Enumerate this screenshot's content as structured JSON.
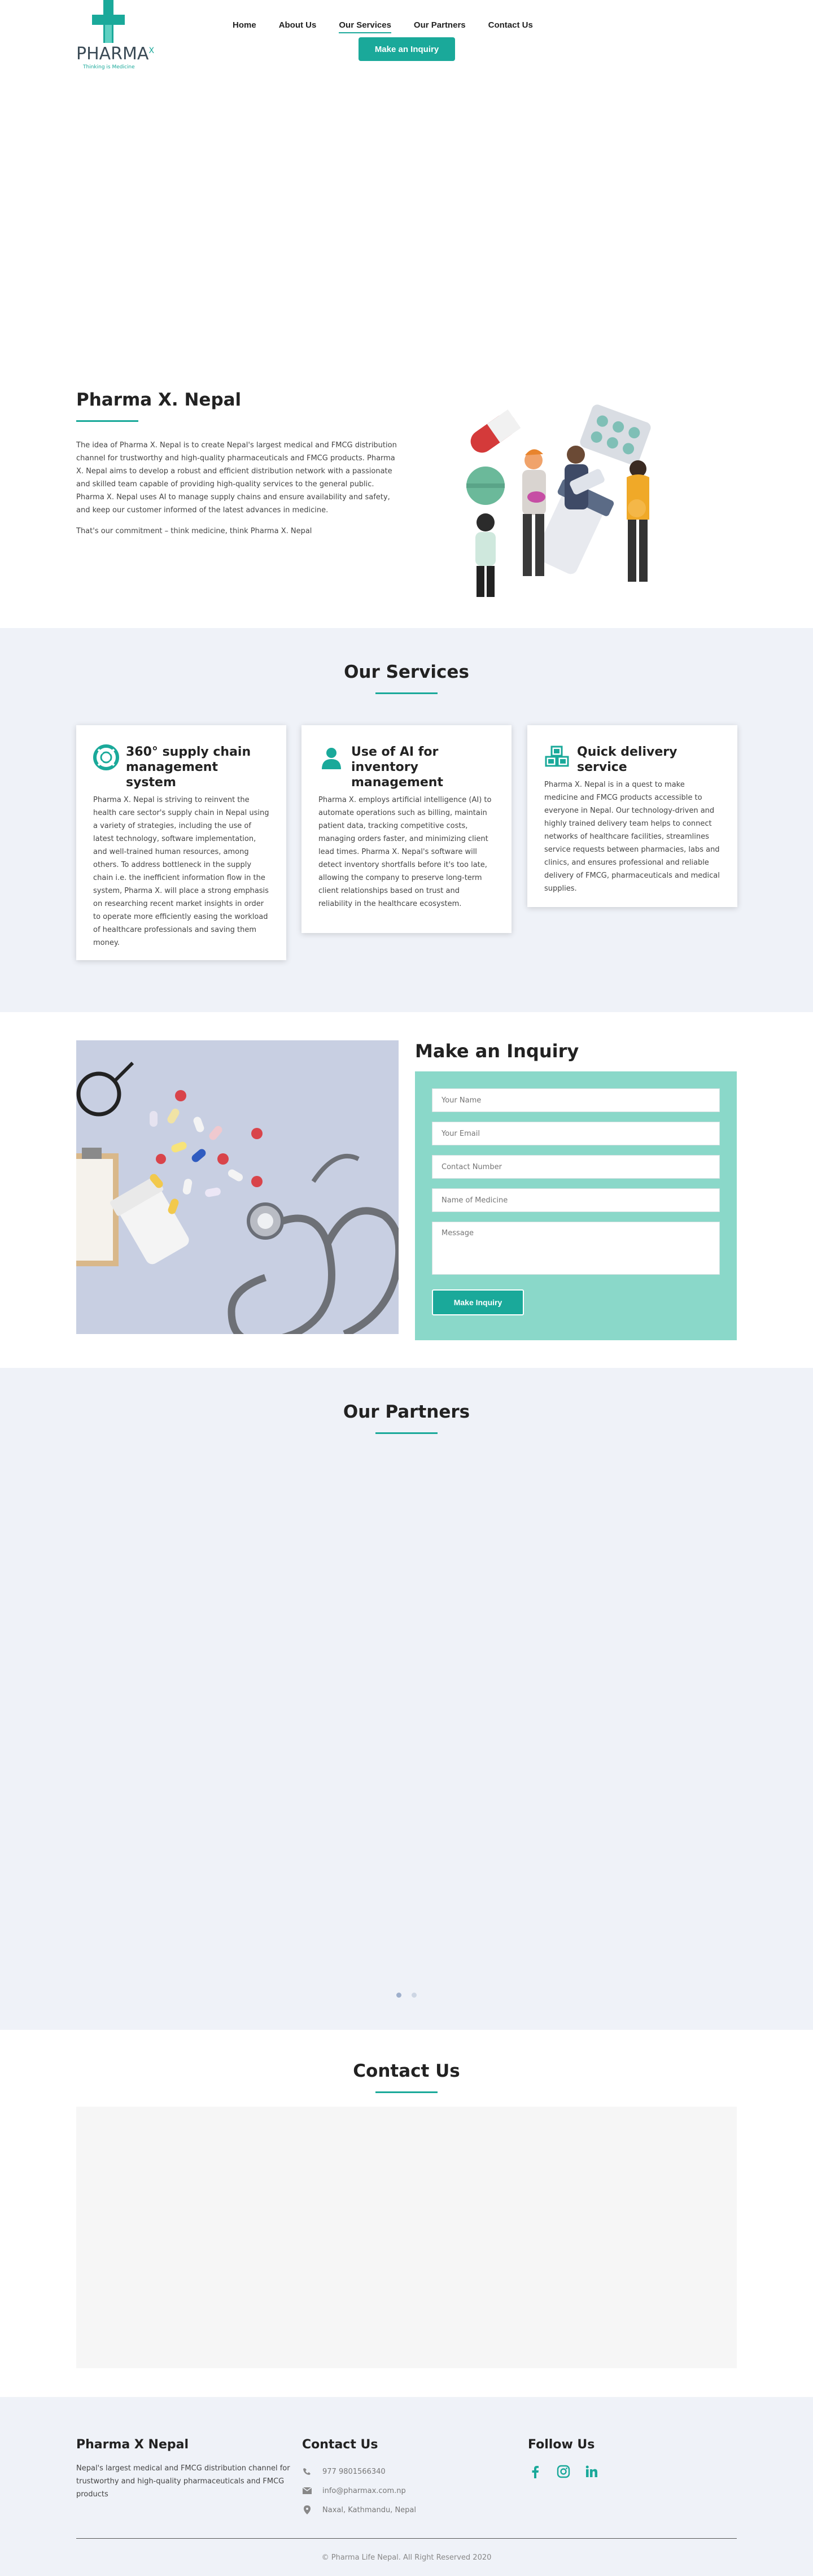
{
  "brand": {
    "logo_text": "PHARMA",
    "logo_superscript": "X",
    "logo_tagline": "Thinking is Medicine",
    "accent_color": "#1aa99a"
  },
  "nav": {
    "items": [
      {
        "label": "Home"
      },
      {
        "label": "About Us"
      },
      {
        "label": "Our Services"
      },
      {
        "label": "Our Partners"
      },
      {
        "label": "Contact Us"
      }
    ],
    "active": "Our Services",
    "inquiry_button": "Make an Inquiry"
  },
  "about": {
    "title": "Pharma X. Nepal",
    "paragraph1": "The idea of Pharma X. Nepal is to create Nepal's largest medical and FMCG distribution channel for trustworthy and high-quality pharmaceuticals and FMCG products. Pharma X. Nepal aims to develop a robust and efficient distribution network with a passionate and skilled team capable of providing high-quality services to the general public. Pharma X. Nepal uses AI to manage supply chains and ensure availability and safety, and keep our customer informed of the latest advances in medicine.",
    "paragraph2": "That's our commitment – think medicine, think Pharma X. Nepal"
  },
  "services": {
    "title": "Our Services",
    "cards": [
      {
        "icon": "lifebuoy-icon",
        "title": "360° supply chain management system",
        "text": "Pharma X. Nepal is striving to reinvent the health care sector's supply chain in Nepal using a variety of strategies, including the use of latest technology, software implementation, and well-trained human resources, among others. To address bottleneck in the supply chain i.e. the inefficient information flow in the system, Pharma X. will place a strong emphasis on researching recent market insights in order to operate more efficiently easing the workload of healthcare professionals and saving them money."
      },
      {
        "icon": "user-icon",
        "title": "Use of AI for inventory management",
        "text": "Pharma X. employs artificial intelligence (AI) to automate operations such as billing, maintain patient data, tracking competitive costs, managing orders faster, and minimizing client lead times. Pharma X. Nepal's software will detect inventory shortfalls before it's too late, allowing the company to preserve long-term client relationships based on trust and reliability in the healthcare ecosystem."
      },
      {
        "icon": "cubes-icon",
        "title": "Quick delivery service",
        "text": "Pharma X. Nepal is in a quest to make medicine and FMCG products accessible to everyone in Nepal. Our technology-driven and highly trained delivery team helps to connect networks of healthcare facilities, streamlines service requests between pharmacies, labs and clinics, and ensures professional and reliable delivery of FMCG, pharmaceuticals and medical supplies."
      }
    ]
  },
  "inquiry": {
    "title": "Make an Inquiry",
    "fields": {
      "name": "Your Name",
      "email": "Your Email",
      "contact": "Contact Number",
      "medicine": "Name of Medicine",
      "message": "Message"
    },
    "submit": "Make Inquiry"
  },
  "partners": {
    "title": "Our Partners"
  },
  "contact": {
    "title": "Contact Us"
  },
  "footer": {
    "about_title": "Pharma X Nepal",
    "about_text": "Nepal's largest medical and FMCG distribution channel for trustworthy and high-quality pharmaceuticals and FMCG products",
    "contact_title": "Contact Us",
    "phone": "977 9801566340",
    "email": "info@pharmax.com.np",
    "address": "Naxal, Kathmandu, Nepal",
    "follow_title": "Follow Us",
    "social": [
      "facebook-icon",
      "instagram-icon",
      "linkedin-icon"
    ],
    "copyright": "© Pharma Life Nepal. All Right Reserved 2020"
  }
}
